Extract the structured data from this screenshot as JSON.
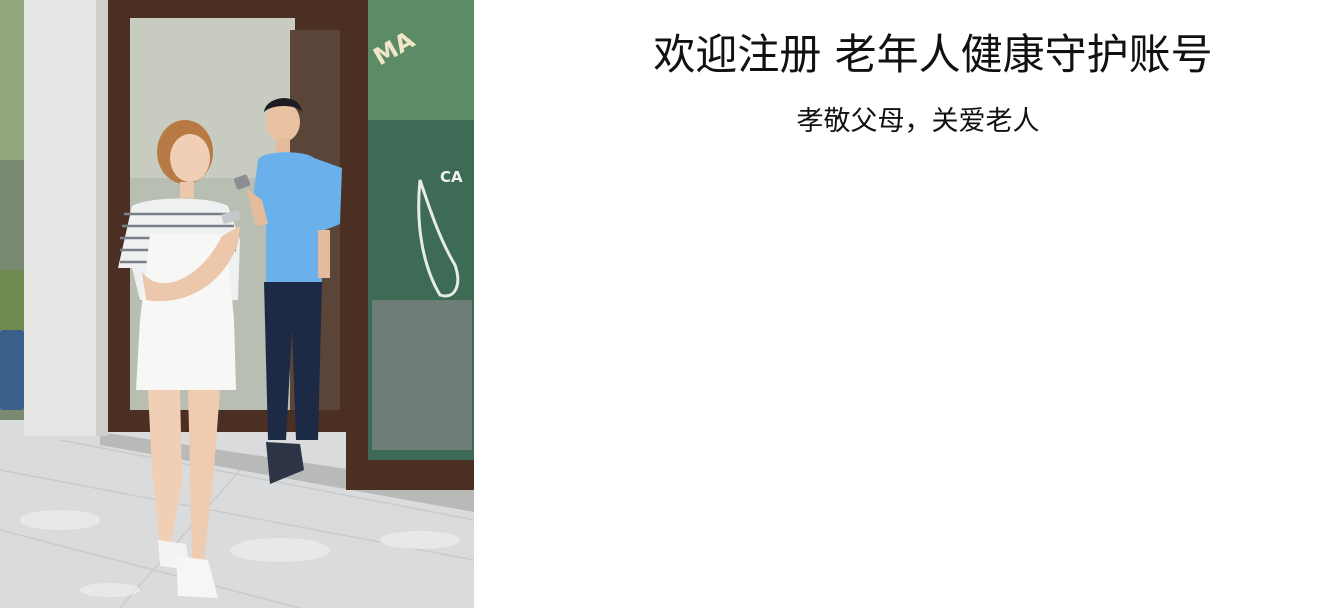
{
  "header": {
    "title": "欢迎注册 老年人健康守护账号",
    "subtitle": "孝敬父母，关爱老人"
  },
  "hero": {
    "shop_sign_fragment_top": "MA",
    "shop_sign_fragment_bottom": "CA"
  },
  "colors": {
    "page_background": "#ffffff",
    "text": "#111111",
    "pavement": "#d9dbdc",
    "door_frame": "#4a2f22",
    "wall": "#e6e6e4",
    "glass": "#3d6b55",
    "shirt_blue": "#6ab0ea",
    "pants_navy": "#1d2a45"
  },
  "icons": {
    "hero_image": "couple-with-phones-photo"
  }
}
